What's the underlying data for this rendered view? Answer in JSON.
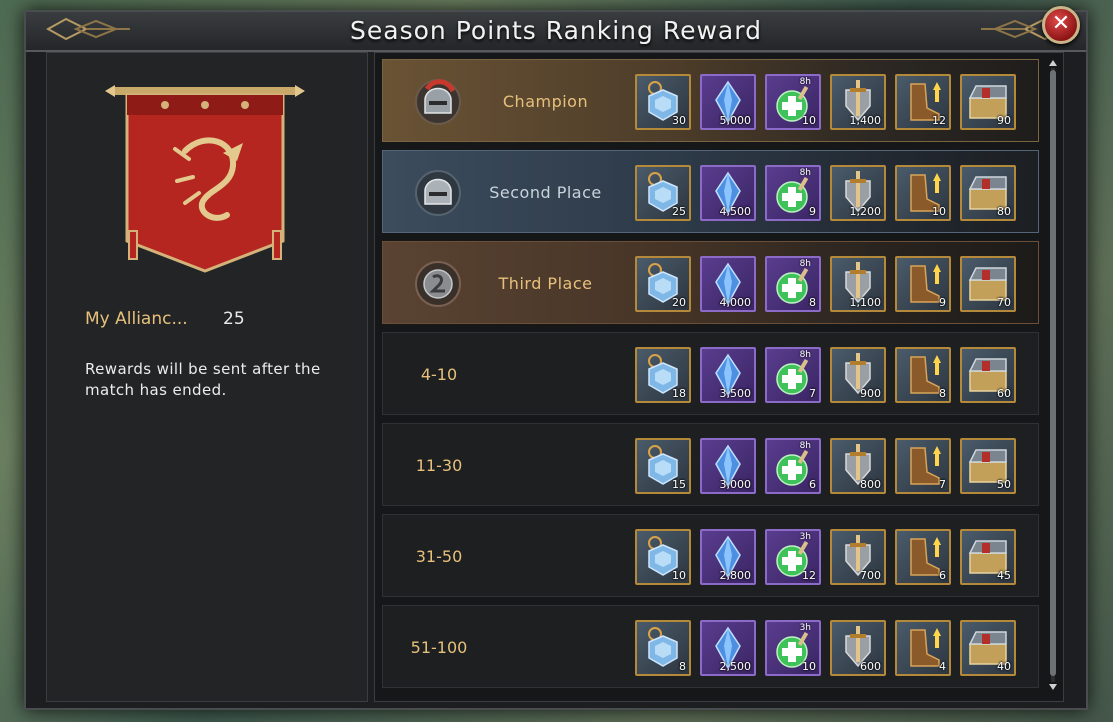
{
  "window": {
    "title": "Season Points Ranking Reward"
  },
  "left_panel": {
    "alliance_label": "My Allianc...",
    "alliance_value": "25",
    "note": "Rewards will be sent after the match has ended."
  },
  "reward_icons": [
    {
      "icon": "blue-crystal-gear-icon",
      "frame": "gold"
    },
    {
      "icon": "blue-diamond-icon",
      "frame": "purple"
    },
    {
      "icon": "green-speedup-potion-icon",
      "frame": "purple"
    },
    {
      "icon": "sword-shield-icon",
      "frame": "gold"
    },
    {
      "icon": "golden-boot-icon",
      "frame": "gold"
    },
    {
      "icon": "treasure-chest-icon",
      "frame": "gold"
    }
  ],
  "ranks": [
    {
      "style": "gold",
      "medal": "champion-helmet-icon",
      "label": "Champion",
      "potion_tag": "8h",
      "counts": [
        "30",
        "5,000",
        "10",
        "1,400",
        "12",
        "90"
      ]
    },
    {
      "style": "silver",
      "medal": "silver-helmet-icon",
      "label": "Second Place",
      "potion_tag": "8h",
      "counts": [
        "25",
        "4,500",
        "9",
        "1,200",
        "10",
        "80"
      ]
    },
    {
      "style": "bronze",
      "medal": "bronze-medal-icon",
      "label": "Third Place",
      "potion_tag": "8h",
      "counts": [
        "20",
        "4,000",
        "8",
        "1,100",
        "9",
        "70"
      ]
    },
    {
      "style": "plain",
      "label": "4-10",
      "potion_tag": "8h",
      "counts": [
        "18",
        "3,500",
        "7",
        "900",
        "8",
        "60"
      ]
    },
    {
      "style": "plain",
      "label": "11-30",
      "potion_tag": "8h",
      "counts": [
        "15",
        "3,000",
        "6",
        "800",
        "7",
        "50"
      ]
    },
    {
      "style": "plain",
      "label": "31-50",
      "potion_tag": "3h",
      "counts": [
        "10",
        "2,800",
        "12",
        "700",
        "6",
        "45"
      ]
    },
    {
      "style": "plain",
      "label": "51-100",
      "potion_tag": "3h",
      "counts": [
        "8",
        "2,500",
        "10",
        "600",
        "4",
        "40"
      ]
    }
  ]
}
